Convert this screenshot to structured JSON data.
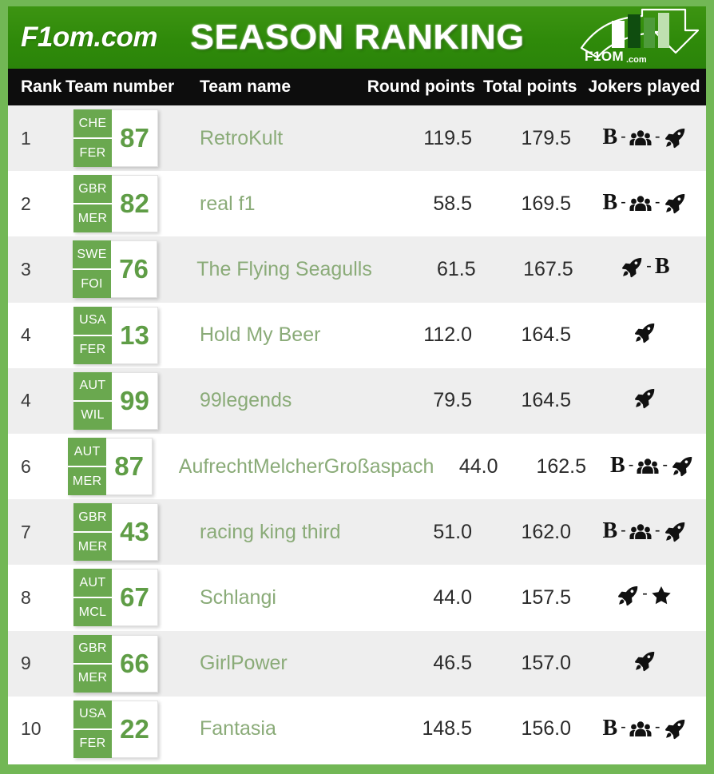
{
  "banner": {
    "brand": "F1om.com",
    "title": "SEASON RANKING",
    "logo_text": "F1OM",
    "logo_suffix": ".com",
    "bg_color": "#2e8b0b",
    "frame_color": "#72b755"
  },
  "table": {
    "headers": {
      "rank": "Rank",
      "team_number": "Team number",
      "team_name": "Team name",
      "round_points": "Round points",
      "total_points": "Total points",
      "jokers_played": "Jokers played"
    },
    "header_bg": "#0d0d0d",
    "accent_color": "#6aa84f",
    "team_name_color": "#8aab78",
    "rows": [
      {
        "rank": "1",
        "code_top": "CHE",
        "code_bottom": "FER",
        "number": "87",
        "team_name": "RetroKult",
        "round_points": "119.5",
        "total_points": "179.5",
        "jokers": [
          "B",
          "group-icon",
          "rocket-icon"
        ]
      },
      {
        "rank": "2",
        "code_top": "GBR",
        "code_bottom": "MER",
        "number": "82",
        "team_name": "real f1",
        "round_points": "58.5",
        "total_points": "169.5",
        "jokers": [
          "B",
          "group-icon",
          "rocket-icon"
        ]
      },
      {
        "rank": "3",
        "code_top": "SWE",
        "code_bottom": "FOI",
        "number": "76",
        "team_name": "The Flying Seagulls",
        "round_points": "61.5",
        "total_points": "167.5",
        "jokers": [
          "rocket-icon",
          "B"
        ]
      },
      {
        "rank": "4",
        "code_top": "USA",
        "code_bottom": "FER",
        "number": "13",
        "team_name": "Hold My Beer",
        "round_points": "112.0",
        "total_points": "164.5",
        "jokers": [
          "rocket-icon"
        ]
      },
      {
        "rank": "4",
        "code_top": "AUT",
        "code_bottom": "WIL",
        "number": "99",
        "team_name": "99legends",
        "round_points": "79.5",
        "total_points": "164.5",
        "jokers": [
          "rocket-icon"
        ]
      },
      {
        "rank": "6",
        "code_top": "AUT",
        "code_bottom": "MER",
        "number": "87",
        "team_name": "AufrechtMelcherGroßaspach",
        "round_points": "44.0",
        "total_points": "162.5",
        "jokers": [
          "B",
          "group-icon",
          "rocket-icon"
        ]
      },
      {
        "rank": "7",
        "code_top": "GBR",
        "code_bottom": "MER",
        "number": "43",
        "team_name": "racing king third",
        "round_points": "51.0",
        "total_points": "162.0",
        "jokers": [
          "B",
          "group-icon",
          "rocket-icon"
        ]
      },
      {
        "rank": "8",
        "code_top": "AUT",
        "code_bottom": "MCL",
        "number": "67",
        "team_name": "Schlangi",
        "round_points": "44.0",
        "total_points": "157.5",
        "jokers": [
          "rocket-icon",
          "star-icon"
        ]
      },
      {
        "rank": "9",
        "code_top": "GBR",
        "code_bottom": "MER",
        "number": "66",
        "team_name": "GirlPower",
        "round_points": "46.5",
        "total_points": "157.0",
        "jokers": [
          "rocket-icon"
        ]
      },
      {
        "rank": "10",
        "code_top": "USA",
        "code_bottom": "FER",
        "number": "22",
        "team_name": "Fantasia",
        "round_points": "148.5",
        "total_points": "156.0",
        "jokers": [
          "B",
          "group-icon",
          "rocket-icon"
        ]
      }
    ]
  }
}
